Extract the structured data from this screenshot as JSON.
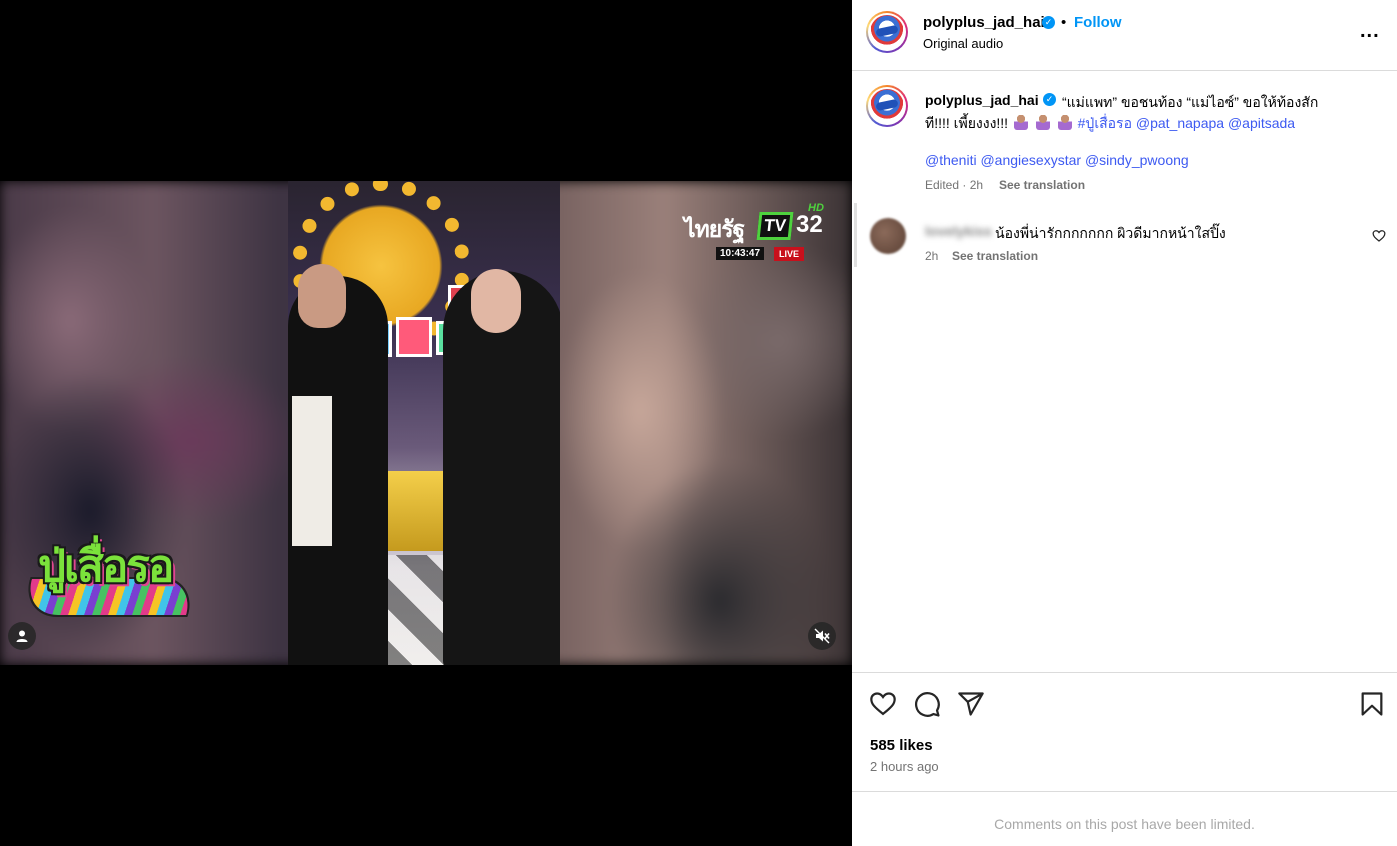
{
  "media": {
    "logo_top_right": {
      "station": "ไทยรัฐ",
      "tv": "TV",
      "channel": "32",
      "hd": "HD",
      "time": "10:43:47",
      "live": "LIVE"
    },
    "show_logo_text": "ปู่เสื่อรอ",
    "icons": {
      "profile": "person-icon",
      "mute": "speaker-muted-icon"
    }
  },
  "header": {
    "username": "polyplus_jad_hai",
    "verified_mark": "✓",
    "separator": "•",
    "follow_label": "Follow",
    "audio": "Original audio",
    "more_label": "..."
  },
  "caption": {
    "username": "polyplus_jad_hai",
    "line1": "“แม่แพท” ขอชนท้อง “แม่ไอซ์” ขอให้ท้องสัก",
    "line2_text": "ที!!!! เพี้ยงงง!!!",
    "line2_hashtag": "#ปู่เสื่อรอ",
    "line2_mention1": "@pat_napapa",
    "line2_mention2": "@apitsada",
    "line3_mention1": "@theniti",
    "line3_mention2": "@angiesexystar",
    "line3_mention3": "@sindy_pwoong",
    "edited": "Edited · 2h",
    "see_translation": "See translation"
  },
  "comment": {
    "username": "lovelykiss",
    "text": "น้องพี่น่ารักกกกกกก ผิวดีมากหน้าใสปิ๊ง",
    "time": "2h",
    "see_translation": "See translation"
  },
  "actions": {
    "icons": [
      "heart-icon",
      "comment-icon",
      "share-icon",
      "bookmark-icon"
    ],
    "likes": "585 likes",
    "posted": "2 hours ago"
  },
  "footer": {
    "limited": "Comments on this post have been limited."
  },
  "colors": {
    "link": "#3d5af1",
    "follow": "#0095f6",
    "muted_text": "#737373",
    "border": "#dbdbdb"
  }
}
